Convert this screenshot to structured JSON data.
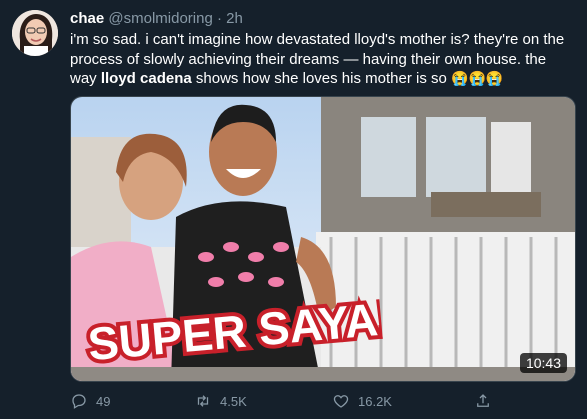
{
  "tweet": {
    "display_name": "chae",
    "handle": "@smolmidoring",
    "separator": "·",
    "time": "2h",
    "text_before": "i'm so sad. i can't imagine how devastated lloyd's mother is? they're on the process of slowly achieving their dreams — having their own house. the way ",
    "text_bold": "lloyd cadena",
    "text_after": " shows how she loves his mother is so",
    "emojis": "😭😭😭"
  },
  "media": {
    "overlay_text": "SUPER SAYA!",
    "duration": "10:43"
  },
  "actions": {
    "reply_count": "49",
    "retweet_count": "4.5K",
    "like_count": "16.2K"
  },
  "colors": {
    "background": "#15202b",
    "secondary_text": "#8899a6",
    "border": "#38444d"
  },
  "icons": [
    "avatar",
    "reply-icon",
    "retweet-icon",
    "like-icon",
    "share-icon"
  ]
}
